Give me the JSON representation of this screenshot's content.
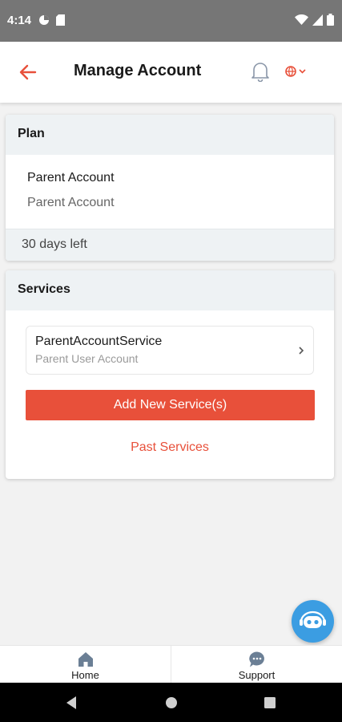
{
  "status_bar": {
    "time": "4:14"
  },
  "header": {
    "title": "Manage Account"
  },
  "plan": {
    "section_title": "Plan",
    "name": "Parent Account",
    "description": "Parent Account",
    "remaining": "30 days left"
  },
  "services": {
    "section_title": "Services",
    "items": [
      {
        "name": "ParentAccountService",
        "description": "Parent User Account"
      }
    ],
    "add_label": "Add New Service(s)",
    "past_label": "Past Services"
  },
  "bottom_nav": {
    "items": [
      {
        "label": "Home",
        "icon": "home-icon"
      },
      {
        "label": "Support",
        "icon": "support-chat-icon"
      }
    ]
  },
  "colors": {
    "accent": "#e8503a",
    "fab": "#3b9de2",
    "nav_icon": "#6b7f95"
  }
}
